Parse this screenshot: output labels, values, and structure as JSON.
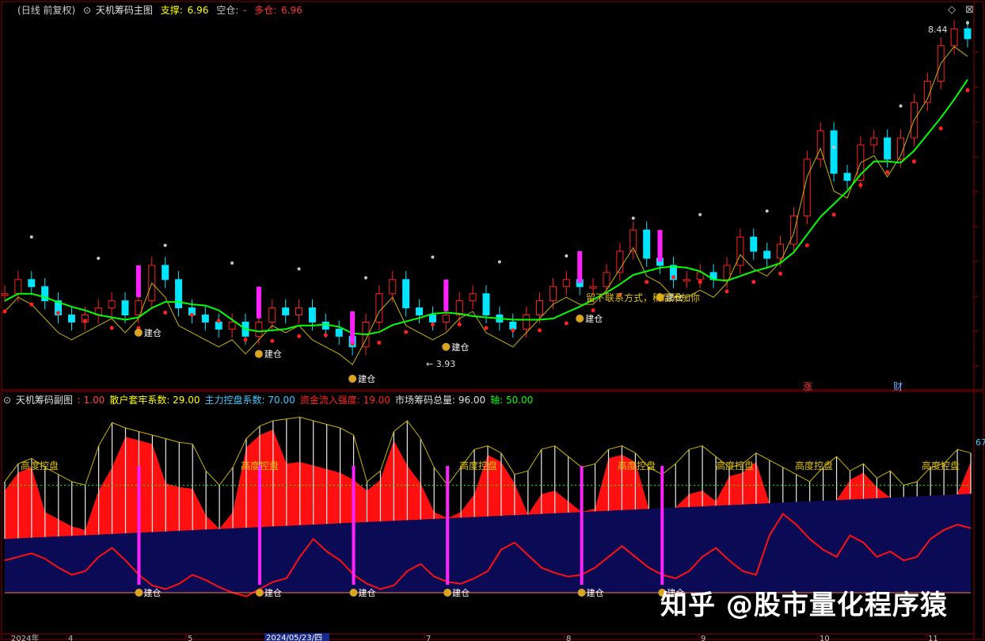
{
  "main_header": {
    "period_label": "日线 前复权",
    "indicator_name": "天机筹码主图",
    "support_label": "支撑:",
    "support_value": "6.96",
    "short_label": "空仓:",
    "short_value": "-",
    "long_label": "多仓:",
    "long_value": "6.96"
  },
  "sub_header": {
    "indicator_name": "天机筹码副图",
    "params": [
      {
        "label": ":",
        "value": "1.00",
        "color": "#ff4040"
      },
      {
        "label": "散户套牢系数:",
        "value": "29.00",
        "color": "#ffff00"
      },
      {
        "label": "主力控盘系数:",
        "value": "70.00",
        "color": "#40c8ff"
      },
      {
        "label": "资金流入强度:",
        "value": "19.00",
        "color": "#ff2020"
      },
      {
        "label": "市场筹码总量:",
        "value": "96.00",
        "color": "#e0e0e0"
      },
      {
        "label": "轴:",
        "value": "50.00",
        "color": "#00ff00"
      }
    ]
  },
  "annotations": {
    "high_price": "8.44",
    "low_price": "3.93",
    "build_label": "建仓",
    "note_text": "留下联系方式，稍后添加你",
    "control_label": "高度控盘",
    "right_edge_value": "67",
    "event_markers": [
      "涨",
      "财"
    ],
    "date_cursor": "2024/05/23/四",
    "x_ticks": [
      "2024年",
      "4",
      "5",
      "7",
      "8",
      "9",
      "10",
      "11"
    ]
  },
  "watermark": {
    "text": "知乎 @股市量化程序猿"
  },
  "colors": {
    "background": "#000000",
    "up": "#ff2020",
    "down": "#00e5ff",
    "support_line": "#00ff00",
    "resistance_dots": "#c8c8c8",
    "grid": "#5a0000"
  },
  "chart_data": [
    {
      "type": "line",
      "title": "天机筹码主图",
      "ylim": [
        3.5,
        8.6
      ],
      "series": [
        {
          "values": [
            4.7,
            4.9,
            4.8,
            4.6,
            4.4,
            4.3,
            4.4,
            4.5,
            4.6,
            4.4,
            4.6,
            5.1,
            4.9,
            4.5,
            4.4,
            4.3,
            4.2,
            4.3,
            4.1,
            4.3,
            4.5,
            4.4,
            4.5,
            4.3,
            4.2,
            4.1,
            3.95,
            4.3,
            4.7,
            4.9,
            4.5,
            4.4,
            4.3,
            4.4,
            4.6,
            4.7,
            4.4,
            4.3,
            4.2,
            4.4,
            4.6,
            4.8,
            4.9,
            4.8,
            4.8,
            5.0,
            5.3,
            5.6,
            5.2,
            5.1,
            4.9,
            4.9,
            5.0,
            4.9,
            5.1,
            5.5,
            5.3,
            5.2,
            5.4,
            5.8,
            6.6,
            7.0,
            6.4,
            6.3,
            6.8,
            6.9,
            6.6,
            6.9,
            7.4,
            7.7,
            8.2,
            8.44,
            8.3
          ]
        }
      ]
    },
    {
      "type": "area",
      "title": "天机筹码副图",
      "ylim": [
        0,
        100
      ],
      "series": [
        {
          "name": "资金流入强度",
          "values": [
            28,
            30,
            32,
            29,
            24,
            20,
            22,
            30,
            35,
            28,
            20,
            14,
            12,
            15,
            20,
            17,
            13,
            10,
            8,
            12,
            16,
            18,
            30,
            40,
            33,
            28,
            20,
            15,
            12,
            14,
            22,
            26,
            19,
            16,
            15,
            18,
            22,
            34,
            38,
            31,
            24,
            21,
            19,
            20,
            24,
            30,
            36,
            30,
            24,
            20,
            18,
            22,
            30,
            35,
            28,
            22,
            20,
            42,
            54,
            48,
            40,
            34,
            30,
            42,
            38,
            30,
            33,
            28,
            30,
            40,
            45,
            48,
            46
          ]
        },
        {
          "name": "市场筹码总量",
          "values": [
            62,
            72,
            75,
            70,
            66,
            62,
            60,
            82,
            95,
            92,
            90,
            88,
            86,
            84,
            83,
            68,
            60,
            70,
            86,
            93,
            96,
            97,
            98,
            96,
            94,
            92,
            88,
            62,
            68,
            90,
            96,
            86,
            70,
            60,
            70,
            80,
            82,
            78,
            66,
            68,
            80,
            82,
            76,
            70,
            72,
            80,
            82,
            78,
            70,
            66,
            72,
            80,
            82,
            76,
            70,
            72,
            78,
            74,
            70,
            66,
            62,
            70,
            76,
            68,
            72,
            64,
            68,
            60,
            62,
            70,
            72,
            80,
            78
          ]
        }
      ]
    }
  ]
}
